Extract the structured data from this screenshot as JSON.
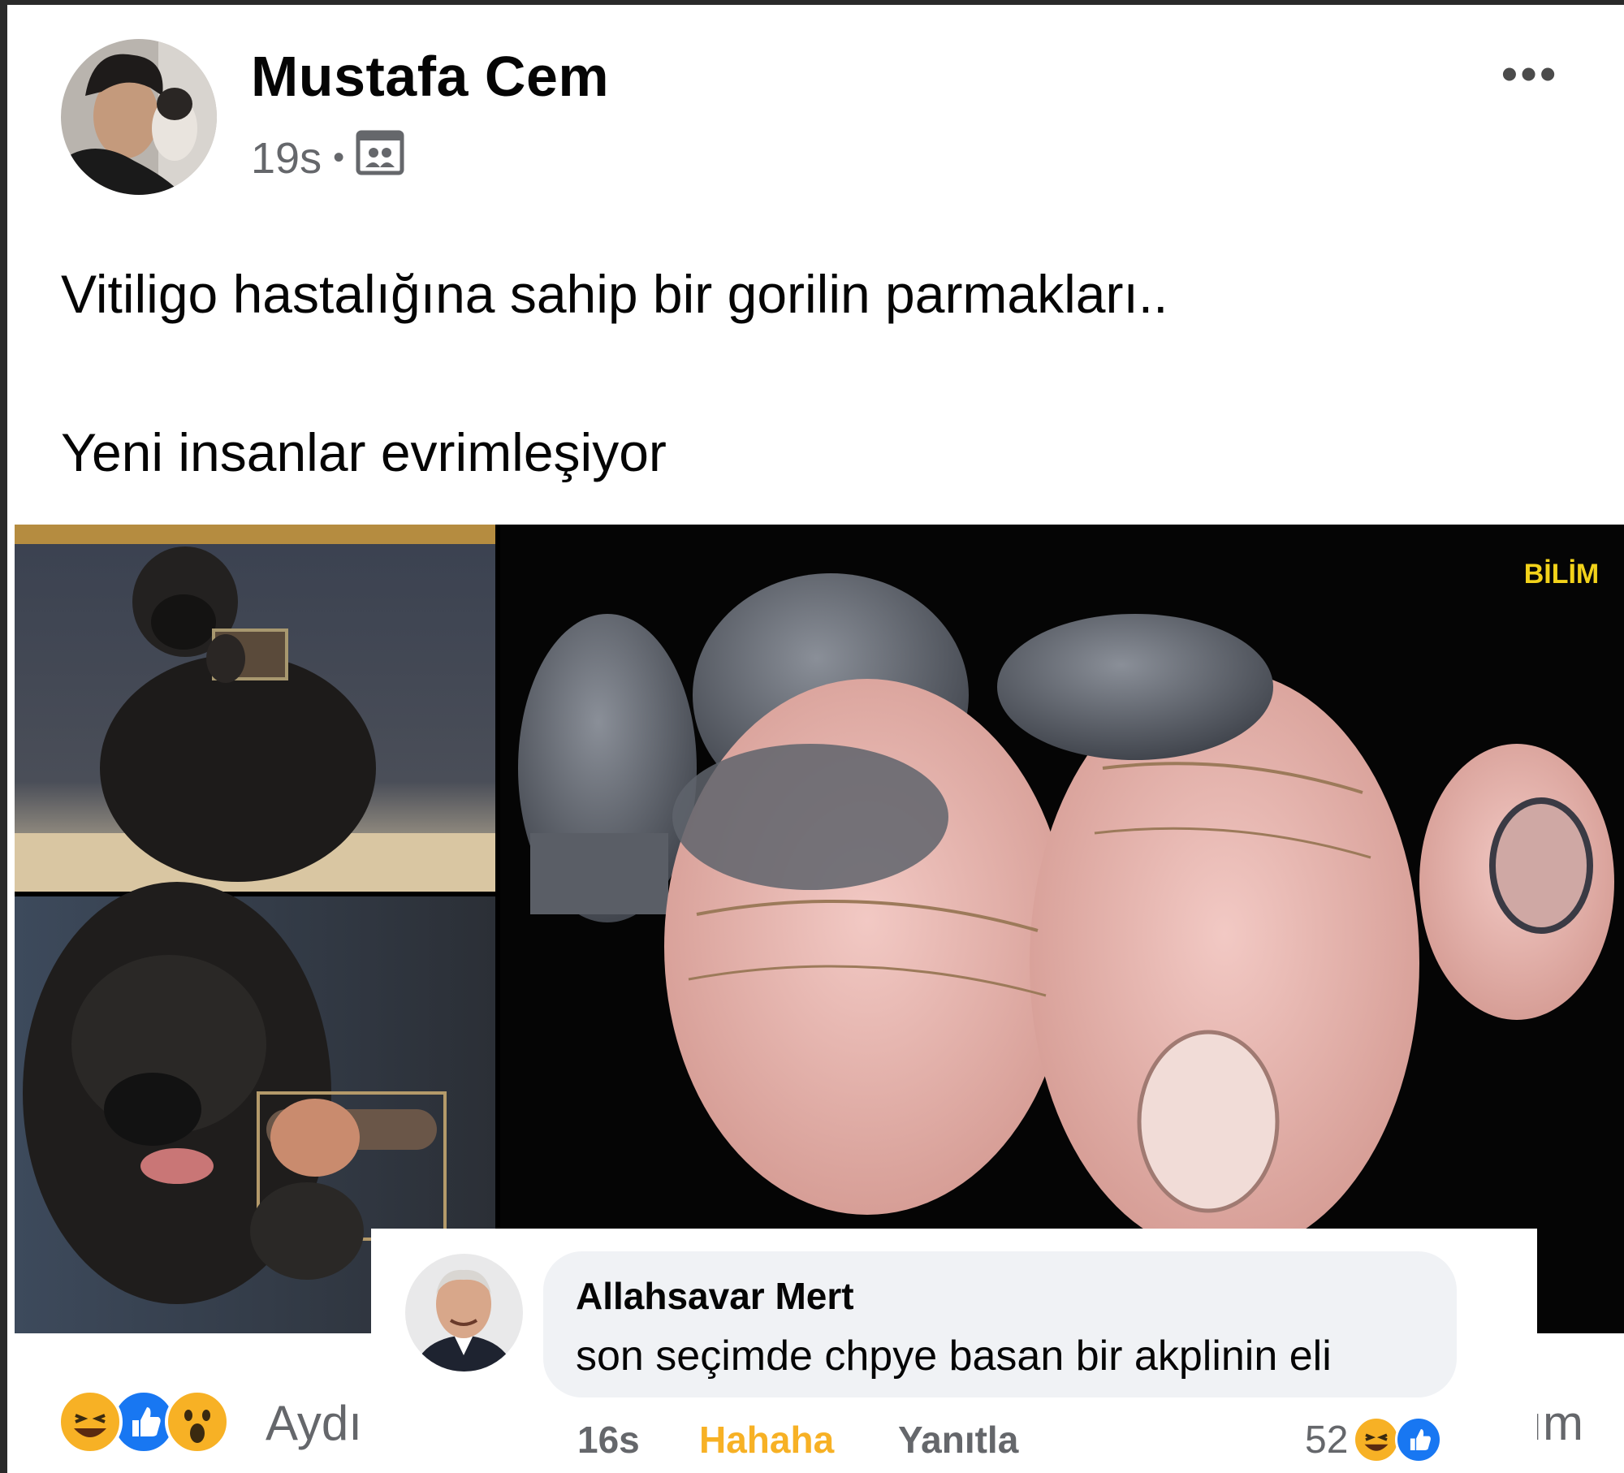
{
  "post": {
    "author": "Mustafa Cem",
    "time": "19s",
    "separator": "•",
    "audience_icon": "group-audience-icon",
    "more_label": "•••",
    "text_line1": "Vitiligo hastalığına sahip bir gorilin parmakları..",
    "text_line2": "Yeni insanlar evrimleşiyor"
  },
  "media": {
    "watermark": "BİLİM"
  },
  "footer": {
    "reactions": [
      "haha-icon",
      "like-icon",
      "wow-icon"
    ],
    "reactor_text": "Aydı",
    "right_partial": "ım"
  },
  "comment": {
    "author": "Allahsavar Mert",
    "text": "son seçimde chpye basan bir akplinin eli",
    "time": "16s",
    "reaction_label": "Hahaha",
    "reply_label": "Yanıtla",
    "reaction_count": "52",
    "reaction_icons": [
      "haha-icon",
      "like-icon"
    ]
  },
  "colors": {
    "haha_yellow": "#f7b125",
    "like_blue": "#1877f2",
    "muted_text": "#65676b",
    "bubble_bg": "#f0f2f5"
  }
}
